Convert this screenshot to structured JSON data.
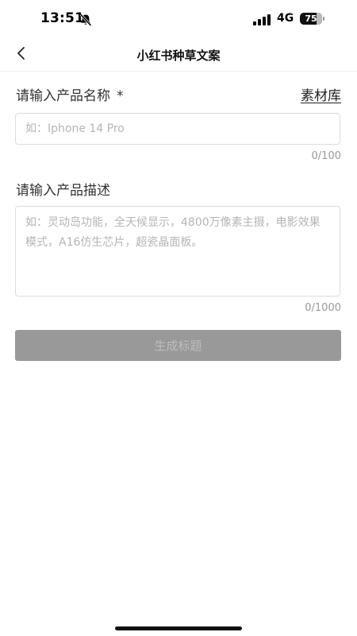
{
  "status_bar": {
    "time": "13:51",
    "network": "4G",
    "battery": "75"
  },
  "nav": {
    "title": "小红书种草文案"
  },
  "form": {
    "product_name": {
      "label": "请输入产品名称",
      "required_mark": "*",
      "placeholder": "如：Iphone 14 Pro",
      "value": "",
      "counter": "0/100"
    },
    "material_library_label": "素材库",
    "product_desc": {
      "label": "请输入产品描述",
      "placeholder": "如：灵动岛功能，全天候显示，4800万像素主摄，电影效果模式，A16仿生芯片，超瓷晶面板。",
      "value": "",
      "counter": "0/1000"
    },
    "generate_button_label": "生成标题"
  },
  "colors": {
    "button_bg": "#999999",
    "button_text": "#bdbdbd",
    "border": "#dcdcdc",
    "placeholder": "#b5b5b5"
  }
}
